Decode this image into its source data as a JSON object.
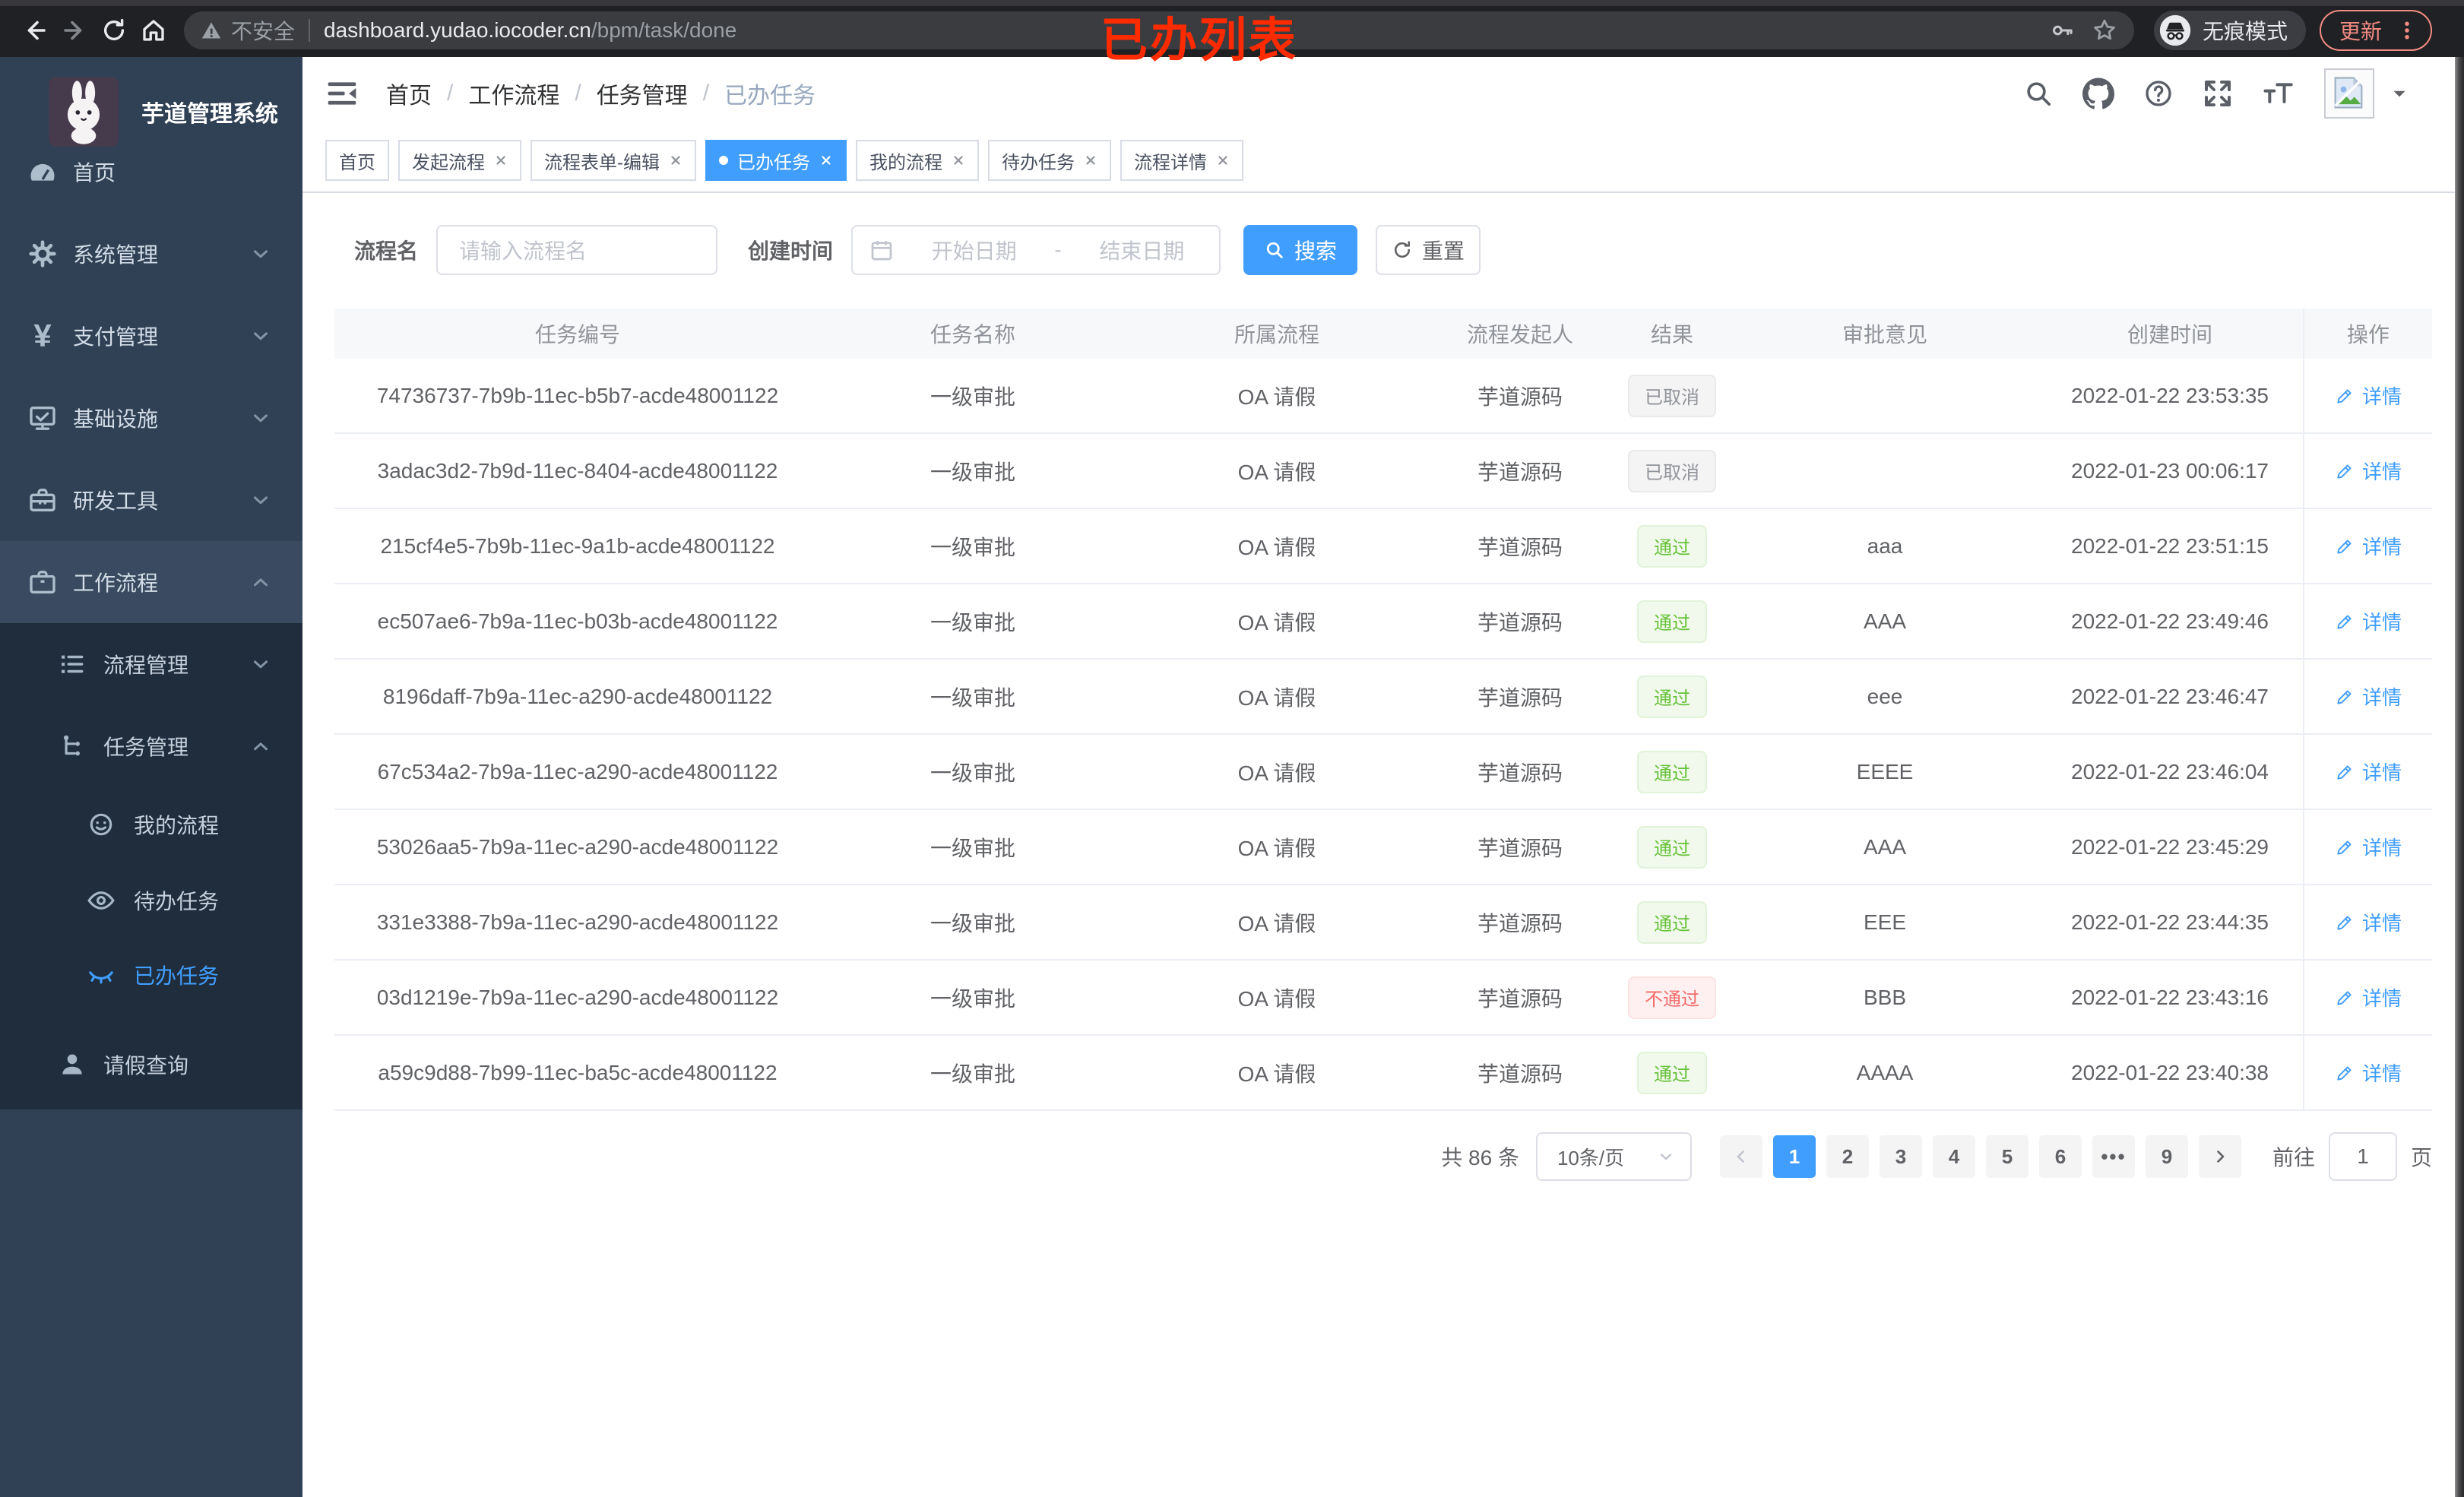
{
  "browser": {
    "security_label": "不安全",
    "url_domain": "dashboard.yudao.iocoder.cn",
    "url_path": "/bpm/task/done",
    "incognito_label": "无痕模式",
    "update_label": "更新"
  },
  "annotation": "已办列表",
  "sidebar": {
    "title": "芋道管理系统",
    "items": {
      "home": "首页",
      "system": "系统管理",
      "payment": "支付管理",
      "infra": "基础设施",
      "devtools": "研发工具",
      "workflow": "工作流程",
      "process_mgmt": "流程管理",
      "task_mgmt": "任务管理",
      "my_process": "我的流程",
      "todo_tasks": "待办任务",
      "done_tasks": "已办任务",
      "leave_query": "请假查询"
    }
  },
  "breadcrumb": {
    "items": [
      "首页",
      "工作流程",
      "任务管理",
      "已办任务"
    ],
    "separator": "/"
  },
  "tabs": [
    {
      "label": "首页"
    },
    {
      "label": "发起流程"
    },
    {
      "label": "流程表单-编辑"
    },
    {
      "label": "已办任务"
    },
    {
      "label": "我的流程"
    },
    {
      "label": "待办任务"
    },
    {
      "label": "流程详情"
    }
  ],
  "filters": {
    "name_label": "流程名",
    "name_placeholder": "请输入流程名",
    "time_label": "创建时间",
    "start_placeholder": "开始日期",
    "range_separator": "-",
    "end_placeholder": "结束日期",
    "search_label": "搜索",
    "reset_label": "重置"
  },
  "table": {
    "columns": [
      "任务编号",
      "任务名称",
      "所属流程",
      "流程发起人",
      "结果",
      "审批意见",
      "创建时间",
      "操作"
    ],
    "action_label": "详情",
    "rows": [
      {
        "id": "74736737-7b9b-11ec-b5b7-acde48001122",
        "name": "一级审批",
        "process": "OA 请假",
        "starter": "芋道源码",
        "result": "已取消",
        "result_type": "info",
        "comment": "",
        "time": "2022-01-22 23:53:35"
      },
      {
        "id": "3adac3d2-7b9d-11ec-8404-acde48001122",
        "name": "一级审批",
        "process": "OA 请假",
        "starter": "芋道源码",
        "result": "已取消",
        "result_type": "info",
        "comment": "",
        "time": "2022-01-23 00:06:17"
      },
      {
        "id": "215cf4e5-7b9b-11ec-9a1b-acde48001122",
        "name": "一级审批",
        "process": "OA 请假",
        "starter": "芋道源码",
        "result": "通过",
        "result_type": "success",
        "comment": "aaa",
        "time": "2022-01-22 23:51:15"
      },
      {
        "id": "ec507ae6-7b9a-11ec-b03b-acde48001122",
        "name": "一级审批",
        "process": "OA 请假",
        "starter": "芋道源码",
        "result": "通过",
        "result_type": "success",
        "comment": "AAA",
        "time": "2022-01-22 23:49:46"
      },
      {
        "id": "8196daff-7b9a-11ec-a290-acde48001122",
        "name": "一级审批",
        "process": "OA 请假",
        "starter": "芋道源码",
        "result": "通过",
        "result_type": "success",
        "comment": "eee",
        "time": "2022-01-22 23:46:47"
      },
      {
        "id": "67c534a2-7b9a-11ec-a290-acde48001122",
        "name": "一级审批",
        "process": "OA 请假",
        "starter": "芋道源码",
        "result": "通过",
        "result_type": "success",
        "comment": "EEEE",
        "time": "2022-01-22 23:46:04"
      },
      {
        "id": "53026aa5-7b9a-11ec-a290-acde48001122",
        "name": "一级审批",
        "process": "OA 请假",
        "starter": "芋道源码",
        "result": "通过",
        "result_type": "success",
        "comment": "AAA",
        "time": "2022-01-22 23:45:29"
      },
      {
        "id": "331e3388-7b9a-11ec-a290-acde48001122",
        "name": "一级审批",
        "process": "OA 请假",
        "starter": "芋道源码",
        "result": "通过",
        "result_type": "success",
        "comment": "EEE",
        "time": "2022-01-22 23:44:35"
      },
      {
        "id": "03d1219e-7b9a-11ec-a290-acde48001122",
        "name": "一级审批",
        "process": "OA 请假",
        "starter": "芋道源码",
        "result": "不通过",
        "result_type": "danger",
        "comment": "BBB",
        "time": "2022-01-22 23:43:16"
      },
      {
        "id": "a59c9d88-7b99-11ec-ba5c-acde48001122",
        "name": "一级审批",
        "process": "OA 请假",
        "starter": "芋道源码",
        "result": "通过",
        "result_type": "success",
        "comment": "AAAA",
        "time": "2022-01-22 23:40:38"
      }
    ]
  },
  "pagination": {
    "total": "共 86 条",
    "page_size": "10条/页",
    "pages": [
      "1",
      "2",
      "3",
      "4",
      "5",
      "6"
    ],
    "ellipsis": "•••",
    "last_page": "9",
    "goto_label": "前往",
    "goto_value": "1",
    "page_unit": "页"
  },
  "colors": {
    "accent": "#409EFF",
    "success": "#67C23A",
    "danger": "#F56C6C",
    "info": "#909399"
  }
}
